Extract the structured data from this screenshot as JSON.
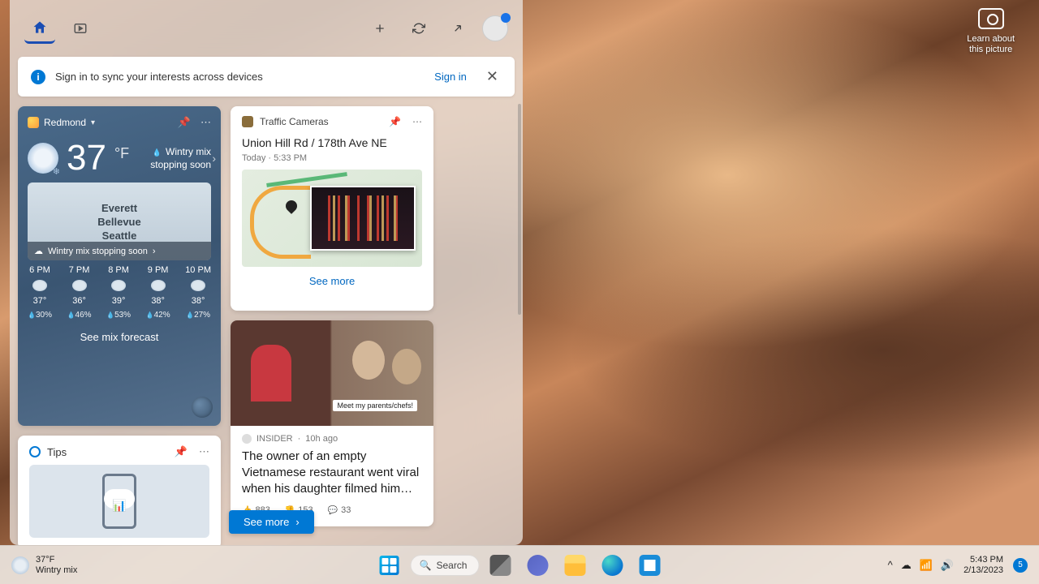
{
  "desktop": {
    "camera_widget": {
      "line1": "Learn about",
      "line2": "this picture"
    }
  },
  "widgets": {
    "signin_banner": {
      "text": "Sign in to sync your interests across devices",
      "link": "Sign in"
    },
    "weather": {
      "location": "Redmond",
      "temp": "37",
      "unit": "°F",
      "condition_line1": "Wintry mix",
      "condition_line2": "stopping soon",
      "map_cities": [
        "Everett",
        "Bellevue",
        "Seattle"
      ],
      "map_banner": "Wintry mix stopping soon",
      "hourly": [
        {
          "time": "6 PM",
          "temp": "37°",
          "precip": "30%"
        },
        {
          "time": "7 PM",
          "temp": "36°",
          "precip": "46%"
        },
        {
          "time": "8 PM",
          "temp": "39°",
          "precip": "53%"
        },
        {
          "time": "9 PM",
          "temp": "38°",
          "precip": "42%"
        },
        {
          "time": "10 PM",
          "temp": "38°",
          "precip": "27%"
        }
      ],
      "see_forecast": "See mix forecast"
    },
    "traffic": {
      "header": "Traffic Cameras",
      "title": "Union Hill Rd / 178th Ave NE",
      "time": "Today · 5:33 PM",
      "see_more": "See more"
    },
    "tips": {
      "header": "Tips"
    },
    "news": {
      "source": "INSIDER",
      "age": "10h ago",
      "caption": "Meet my parents/chefs!",
      "title": "The owner of an empty Vietnamese restaurant went viral when his daughter filmed him…",
      "likes": "883",
      "dislikes": "153",
      "comments": "33"
    },
    "see_more_button": "See more"
  },
  "taskbar": {
    "weather": {
      "temp": "37°F",
      "condition": "Wintry mix"
    },
    "search_placeholder": "Search",
    "time": "5:43 PM",
    "date": "2/13/2023",
    "notification_count": "5"
  }
}
